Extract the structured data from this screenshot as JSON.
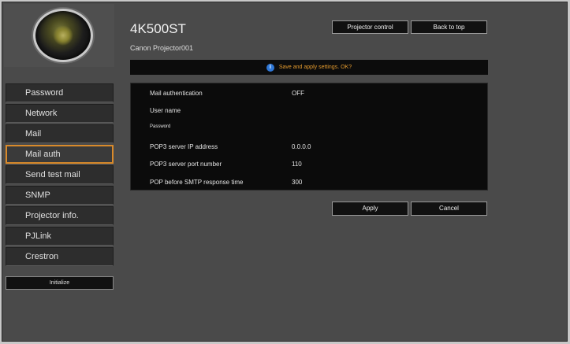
{
  "header": {
    "model": "4K500ST",
    "device_name": "Canon Projector001",
    "projector_control_label": "Projector control",
    "back_to_top_label": "Back to top"
  },
  "sidebar": {
    "items": [
      {
        "label": "Password"
      },
      {
        "label": "Network"
      },
      {
        "label": "Mail"
      },
      {
        "label": "Mail auth"
      },
      {
        "label": "Send test mail"
      },
      {
        "label": "SNMP"
      },
      {
        "label": "Projector info."
      },
      {
        "label": "PJLink"
      },
      {
        "label": "Crestron"
      }
    ],
    "active_index": 3,
    "initialize_label": "Initialize"
  },
  "message": {
    "icon": "info-icon",
    "text": "Save and apply settings. OK?"
  },
  "settings": {
    "rows": [
      {
        "label": "Mail authentication",
        "value": "OFF"
      },
      {
        "label": "User name",
        "value": ""
      },
      {
        "label": "Password",
        "value": ""
      },
      {
        "label": "POP3 server IP address",
        "value": "0.0.0.0"
      },
      {
        "label": "POP3 server port number",
        "value": "110"
      },
      {
        "label": "POP before SMTP response time",
        "value": "300"
      }
    ]
  },
  "actions": {
    "apply_label": "Apply",
    "cancel_label": "Cancel"
  },
  "colors": {
    "accent": "#d98a2b",
    "message_text": "#e39a2e",
    "info_icon": "#2f78d8"
  }
}
